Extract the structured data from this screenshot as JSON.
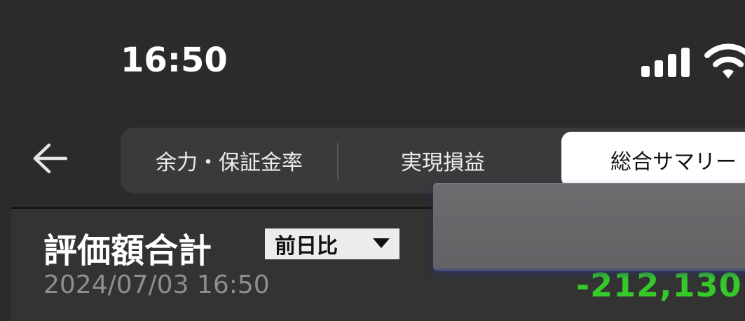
{
  "status_bar": {
    "time": "16:50",
    "icons": [
      "signal-icon",
      "wifi-icon"
    ]
  },
  "nav": {
    "back_icon": "back-arrow-icon",
    "tabs": [
      {
        "label": "余力・保証金率",
        "active": false
      },
      {
        "label": "実現損益",
        "active": false
      },
      {
        "label": "総合サマリー",
        "active": true
      }
    ]
  },
  "summary": {
    "title": "評価額合計",
    "compare_select": "前日比",
    "timestamp": "2024/07/03 16:50",
    "value": "-212,130 -"
  },
  "colors": {
    "background": "#2b2b2b",
    "positive_change": "#36c92a",
    "active_tab_bg": "#ffffff"
  }
}
